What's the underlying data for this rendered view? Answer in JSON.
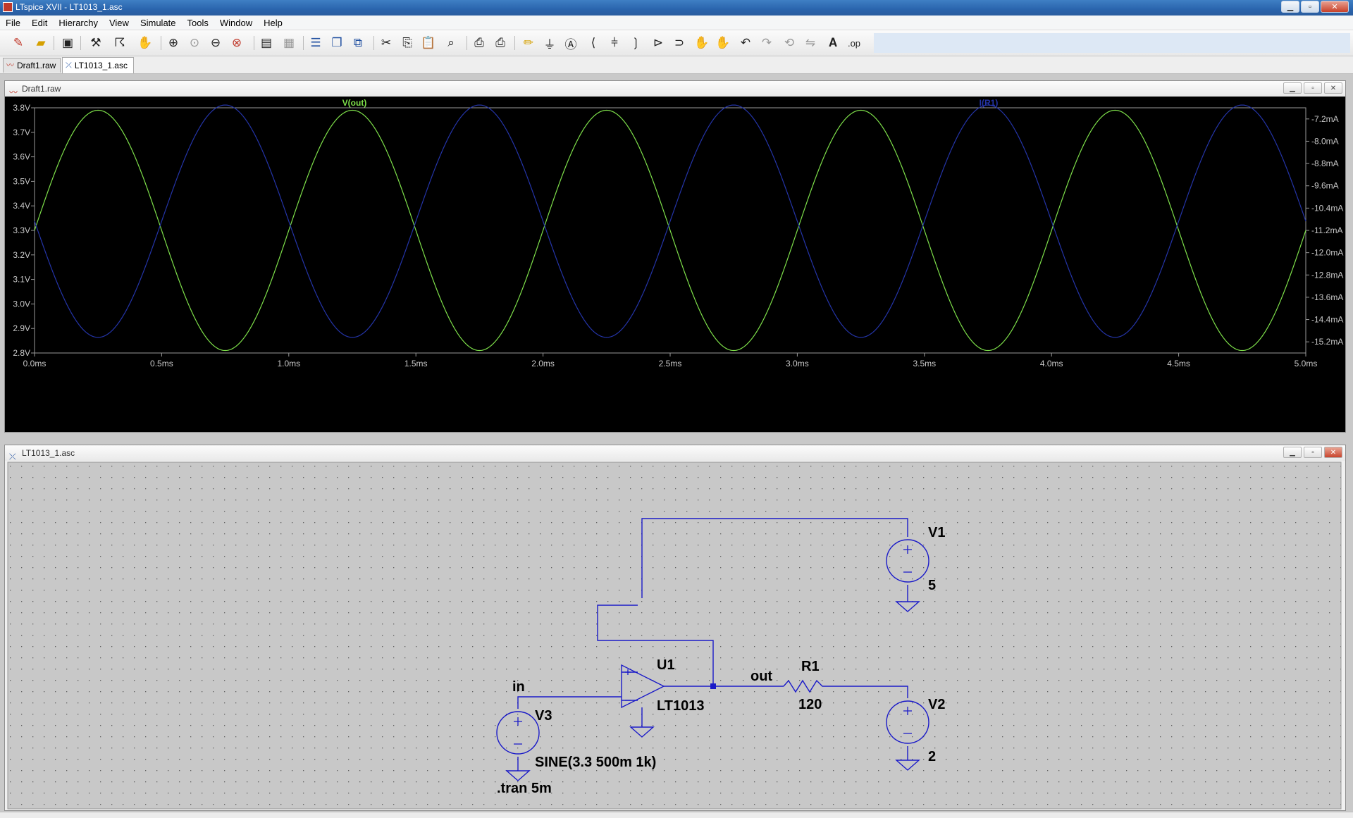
{
  "window": {
    "title": "LTspice XVII - LT1013_1.asc"
  },
  "menu": [
    "File",
    "Edit",
    "Hierarchy",
    "View",
    "Simulate",
    "Tools",
    "Window",
    "Help"
  ],
  "tabs": [
    {
      "label": "Draft1.raw",
      "active": false
    },
    {
      "label": "LT1013_1.asc",
      "active": true
    }
  ],
  "waveform_panel": {
    "title": "Draft1.raw"
  },
  "schematic_panel": {
    "title": "LT1013_1.asc"
  },
  "chart_data": {
    "type": "line",
    "x": {
      "min": 0,
      "max": 5.0,
      "unit": "ms",
      "ticks": [
        "0.0ms",
        "0.5ms",
        "1.0ms",
        "1.5ms",
        "2.0ms",
        "2.5ms",
        "3.0ms",
        "3.5ms",
        "4.0ms",
        "4.5ms",
        "5.0ms"
      ]
    },
    "y_left": {
      "min": 2.8,
      "max": 3.8,
      "ticks": [
        "3.8V",
        "3.7V",
        "3.6V",
        "3.5V",
        "3.4V",
        "3.3V",
        "3.2V",
        "3.1V",
        "3.0V",
        "2.9V",
        "2.8V"
      ]
    },
    "y_right": {
      "min": -15.6,
      "max": -6.8,
      "ticks": [
        "-7.2mA",
        "-8.0mA",
        "-8.8mA",
        "-9.6mA",
        "-10.4mA",
        "-11.2mA",
        "-12.0mA",
        "-12.8mA",
        "-13.6mA",
        "-14.4mA",
        "-15.2mA"
      ]
    },
    "grid": false,
    "series": [
      {
        "name": "V(out)",
        "axis": "left",
        "color": "#7ee04a",
        "offset": 3.3,
        "amplitude": 0.49,
        "frequency_khz": 1,
        "phase": "sine"
      },
      {
        "name": "I(R1)",
        "axis": "right",
        "color": "#2434a8",
        "offset": -10.87,
        "amplitude": 4.17,
        "frequency_khz": 1,
        "phase": "inverted-sine"
      }
    ]
  },
  "schematic": {
    "labels": {
      "in": "in",
      "out": "out",
      "u1": "U1",
      "u1_model": "LT1013",
      "r1": "R1",
      "r1_value": "120",
      "v1": "V1",
      "v1_value": "5",
      "v2": "V2",
      "v2_value": "2",
      "v3": "V3",
      "v3_value": "SINE(3.3 500m 1k)",
      "tran": ".tran 5m"
    },
    "colors": {
      "wire": "#1a1ac8",
      "background": "#c8c8c8",
      "text": "#000000"
    }
  }
}
